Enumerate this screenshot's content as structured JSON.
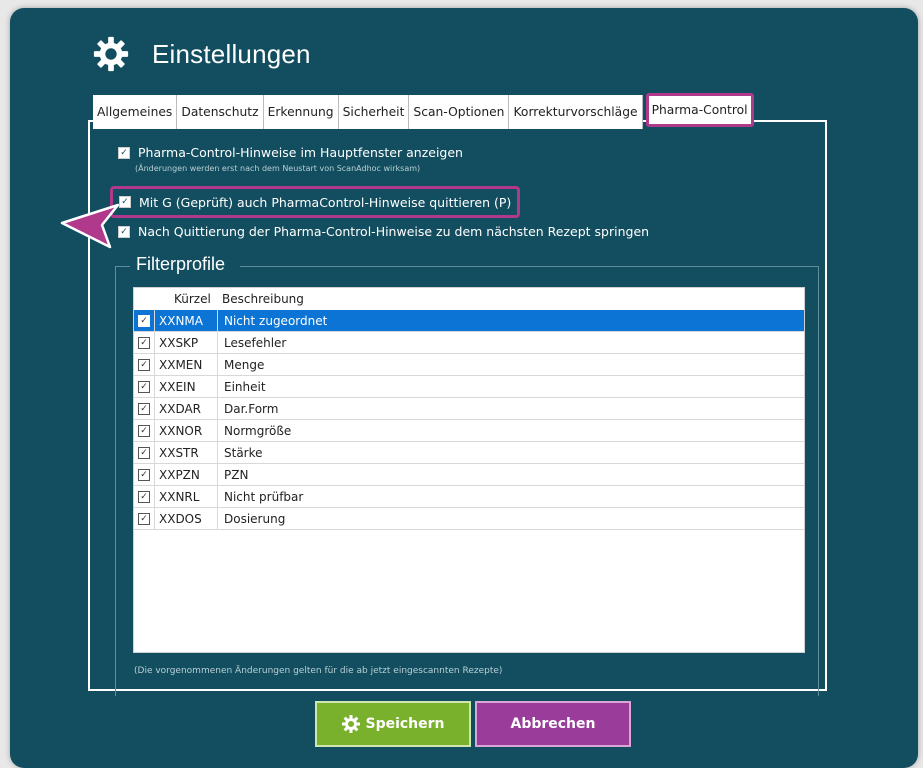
{
  "window": {
    "title": "Einstellungen"
  },
  "tabs": [
    {
      "label": "Allgemeines"
    },
    {
      "label": "Datenschutz"
    },
    {
      "label": "Erkennung"
    },
    {
      "label": "Sicherheit"
    },
    {
      "label": "Scan-Optionen"
    },
    {
      "label": "Korrekturvorschläge"
    },
    {
      "label": "Pharma-Control",
      "active": true
    }
  ],
  "options": {
    "show_hints": {
      "label": "Pharma-Control-Hinweise im Hauptfenster anzeigen",
      "checked": true,
      "hint": "(Änderungen werden erst nach dem Neustart von ScanAdhoc wirksam)"
    },
    "ack_with_g": {
      "label": "Mit G (Geprüft) auch PharmaControl-Hinweise quittieren (P)",
      "checked": true
    },
    "jump_next": {
      "label": "Nach Quittierung der Pharma-Control-Hinweise zu dem nächsten Rezept springen",
      "checked": true
    }
  },
  "filter": {
    "title": "Filterprofile",
    "columns": {
      "code": "Kürzel",
      "description": "Beschreibung"
    },
    "rows": [
      {
        "code": "XXNMA",
        "description": "Nicht zugeordnet",
        "checked": true,
        "selected": true
      },
      {
        "code": "XXSKP",
        "description": "Lesefehler",
        "checked": true
      },
      {
        "code": "XXMEN",
        "description": "Menge",
        "checked": true
      },
      {
        "code": "XXEIN",
        "description": "Einheit",
        "checked": true
      },
      {
        "code": "XXDAR",
        "description": "Dar.Form",
        "checked": true
      },
      {
        "code": "XXNOR",
        "description": "Normgröße",
        "checked": true
      },
      {
        "code": "XXSTR",
        "description": "Stärke",
        "checked": true
      },
      {
        "code": "XXPZN",
        "description": "PZN",
        "checked": true
      },
      {
        "code": "XXNRL",
        "description": "Nicht prüfbar",
        "checked": true
      },
      {
        "code": "XXDOS",
        "description": "Dosierung",
        "checked": true
      }
    ],
    "footnote": "(Die vorgenommenen Änderungen gelten für die ab jetzt eingescannten Rezepte)"
  },
  "buttons": {
    "save": "Speichern",
    "cancel": "Abbrechen"
  },
  "colors": {
    "background": "#124e5f",
    "highlight": "#b0398b",
    "save": "#79b02c",
    "cancel": "#9a3c9a",
    "selection": "#0b74d4"
  },
  "icons": {
    "title": "gear-icon",
    "save": "gear-icon",
    "pointer": "arrow-pointer-icon"
  }
}
